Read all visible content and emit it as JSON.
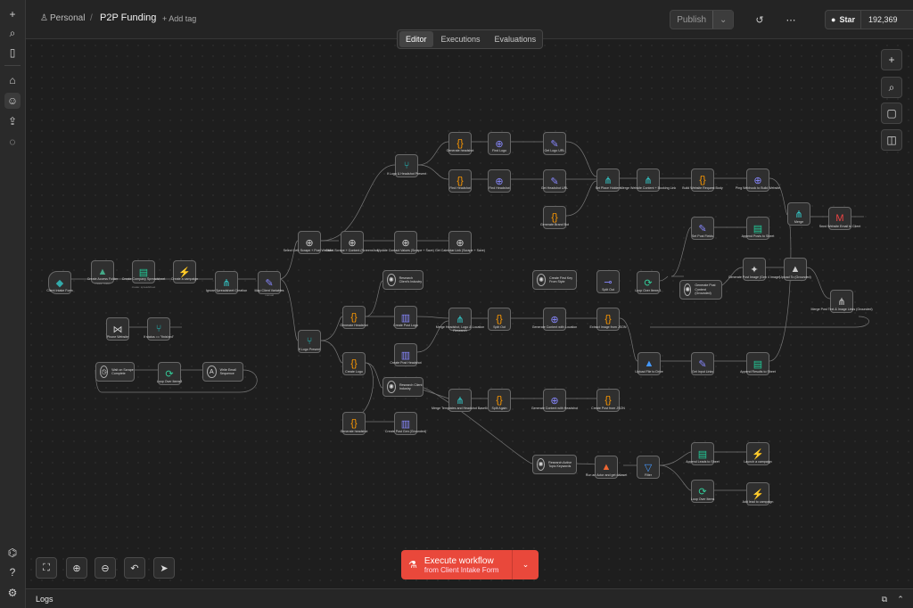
{
  "header": {
    "breadcrumb_project": "Personal",
    "breadcrumb_separator": "/",
    "workflow_title": "P2P Funding",
    "add_tag": "+ Add tag",
    "publish_label": "Publish",
    "github_star_label": "Star",
    "github_star_count": "192,369"
  },
  "tabs": [
    {
      "label": "Editor",
      "active": true
    },
    {
      "label": "Executions",
      "active": false
    },
    {
      "label": "Evaluations",
      "active": false
    }
  ],
  "nodes": {
    "client_intake": {
      "label": "Client Intake Form"
    },
    "create_access_folder": {
      "label": "Create Access Folder",
      "sub": "create: folder"
    },
    "create_company_spreadsheet": {
      "label": "Create Company Spreadsheet",
      "sub": "create: spreadsheet"
    },
    "create_campaign_1": {
      "label": "Create a campaign"
    },
    "ignore_spreadsheet": {
      "label": "Ignore Spreadsheet Creation"
    },
    "map_client_variables": {
      "label": "Map Client Variables",
      "sub": "manual"
    },
    "website_crawl": {
      "label": "Select Cell: Scrape + Post Website...",
      "sub": "POST: https://api.firecrawl.dev"
    },
    "client_scrape": {
      "label": "Client Scrape + Content (Screenshot)",
      "sub": "POST: https://api.firecrawl.dev"
    },
    "update_contact": {
      "label": "Update Contact Values (Scrape + Save)"
    },
    "get_calendar_link": {
      "label": "Get Calendar Link (Scrape + Save)"
    },
    "if_logo": {
      "label": "If Logo & Headshot Present",
      "sub": "Is Not Empty"
    },
    "generate_headshot": {
      "label": "Generate headshot"
    },
    "find_logo": {
      "label": "Find Logo",
      "sub": "POST: https://api.brandfetch"
    },
    "get_logo_url": {
      "label": "Get Logo URL"
    },
    "find_headshot": {
      "label": "Find Headshot",
      "sub": "POST: https://api.firecrawl.dev"
    },
    "get_headshot_url": {
      "label": "Get Headshot URL"
    },
    "set_place_holders": {
      "label": "Set Place Holders",
      "sub": "combine"
    },
    "generate_brand_bot": {
      "label": "Generate Brand Bot"
    },
    "merge_website_content": {
      "label": "Merge Website Content + Booking Link"
    },
    "build_url": {
      "label": "Build Website Request Body"
    },
    "post_webhook": {
      "label": "Ping Webhook to Build Website",
      "sub": "POST: https://..."
    },
    "merge_final": {
      "label": "Merge"
    },
    "send_email": {
      "label": "Send Website Email to Client",
      "sub": "send: message"
    },
    "set_post_fields": {
      "label": "Set Post Fields",
      "sub": "manual"
    },
    "append_row_1": {
      "label": "Append Posts to Sheet",
      "sub": "append: sheet"
    },
    "loop_over_items_1": {
      "label": "Loop Over Items 1"
    },
    "generate_content": {
      "label": "Generate Post Content (Grounded)",
      "sub": "message: model"
    },
    "generate_image": {
      "label": "Generate Post Image (Gen 4 Image)"
    },
    "upload_drive": {
      "label": "Upload To (Grounded)",
      "sub": "upload: file"
    },
    "merge_post": {
      "label": "Merge Post Text & Image Links (Grounded)"
    },
    "openai_client": {
      "label": "Research Client's Industry",
      "sub": "message: model"
    },
    "create_post_logo": {
      "label": "Create Post Logo",
      "sub": "POST: https://..."
    },
    "create_post_headshot": {
      "label": "Create Post Headshot"
    },
    "if_logo_present": {
      "label": "If Logo Present"
    },
    "generate_headshot_2": {
      "label": "Generate Headshot"
    },
    "create_logo": {
      "label": "Create Logo"
    },
    "merge_content": {
      "label": "Merge Headshot, Logo & Location Research",
      "sub": "append"
    },
    "split_out": {
      "label": "Split Out"
    },
    "generate_copy": {
      "label": "Generate Content with Location",
      "sub": "POST: https://..."
    },
    "extract_json": {
      "label": "Extract Image from JSON"
    },
    "create_first": {
      "label": "Create First Key From Style"
    },
    "split_out_2": {
      "label": "Split Out"
    },
    "loop_over_items_2": {
      "label": "Loop Over Items 2"
    },
    "upload_to_drive": {
      "label": "Upload File to Drive",
      "sub": "upload: file"
    },
    "get_input_links": {
      "label": "Get Input Links",
      "sub": "manual"
    },
    "append_results": {
      "label": "Append Results to Sheet",
      "sub": "append: sheet"
    },
    "research_client": {
      "label": "Research Client Industry"
    },
    "create_post_gbp": {
      "label": "Create Post Gen (Grounded)",
      "sub": "POST: https://..."
    },
    "generate_headshot_3": {
      "label": "Generate headshot"
    },
    "merge_templates": {
      "label": "Merge Templates and Headshot Base64",
      "sub": "append"
    },
    "split_again": {
      "label": "Split Again"
    },
    "generate_content_2": {
      "label": "Generate Content with Headshot",
      "sub": "POST: https://..."
    },
    "create_post_json": {
      "label": "Create Post from JSON"
    },
    "research_openai": {
      "label": "Research Active Topic Keywords",
      "sub": "message: model"
    },
    "run_actor": {
      "label": "Run an Actor and get dataset",
      "sub": "Trigger"
    },
    "filter": {
      "label": "Filter",
      "sub": "Matches"
    },
    "append_leads": {
      "label": "Append Leads to Sheet",
      "sub": "append: sheet"
    },
    "launch_campaign": {
      "label": "Launch a campaign"
    },
    "loop_over_leads": {
      "label": "Loop Over Items"
    },
    "add_leads": {
      "label": "Add lead to campaign"
    },
    "phone_website": {
      "label": "Phone Website"
    },
    "if_status": {
      "label": "If status == \"finished\""
    },
    "wait": {
      "label": "Wait on Scrape Complete",
      "sub": "wait: 5m"
    },
    "loop_over_items_3": {
      "label": "Loop Over Items3"
    },
    "write_email": {
      "label": "Write Email Sequence",
      "sub": "message: model"
    }
  },
  "edge_labels": {
    "done_1": "done",
    "loop_1": "loop",
    "true_1": "true",
    "false_1": "false"
  },
  "execute": {
    "title": "Execute workflow",
    "subtitle": "from Client Intake Form"
  },
  "logs": {
    "label": "Logs"
  },
  "colors": {
    "execute_button": "#e9483b",
    "canvas_bg": "#1e1e1e",
    "node_bg": "#2f2f2f",
    "edge": "#777777"
  }
}
